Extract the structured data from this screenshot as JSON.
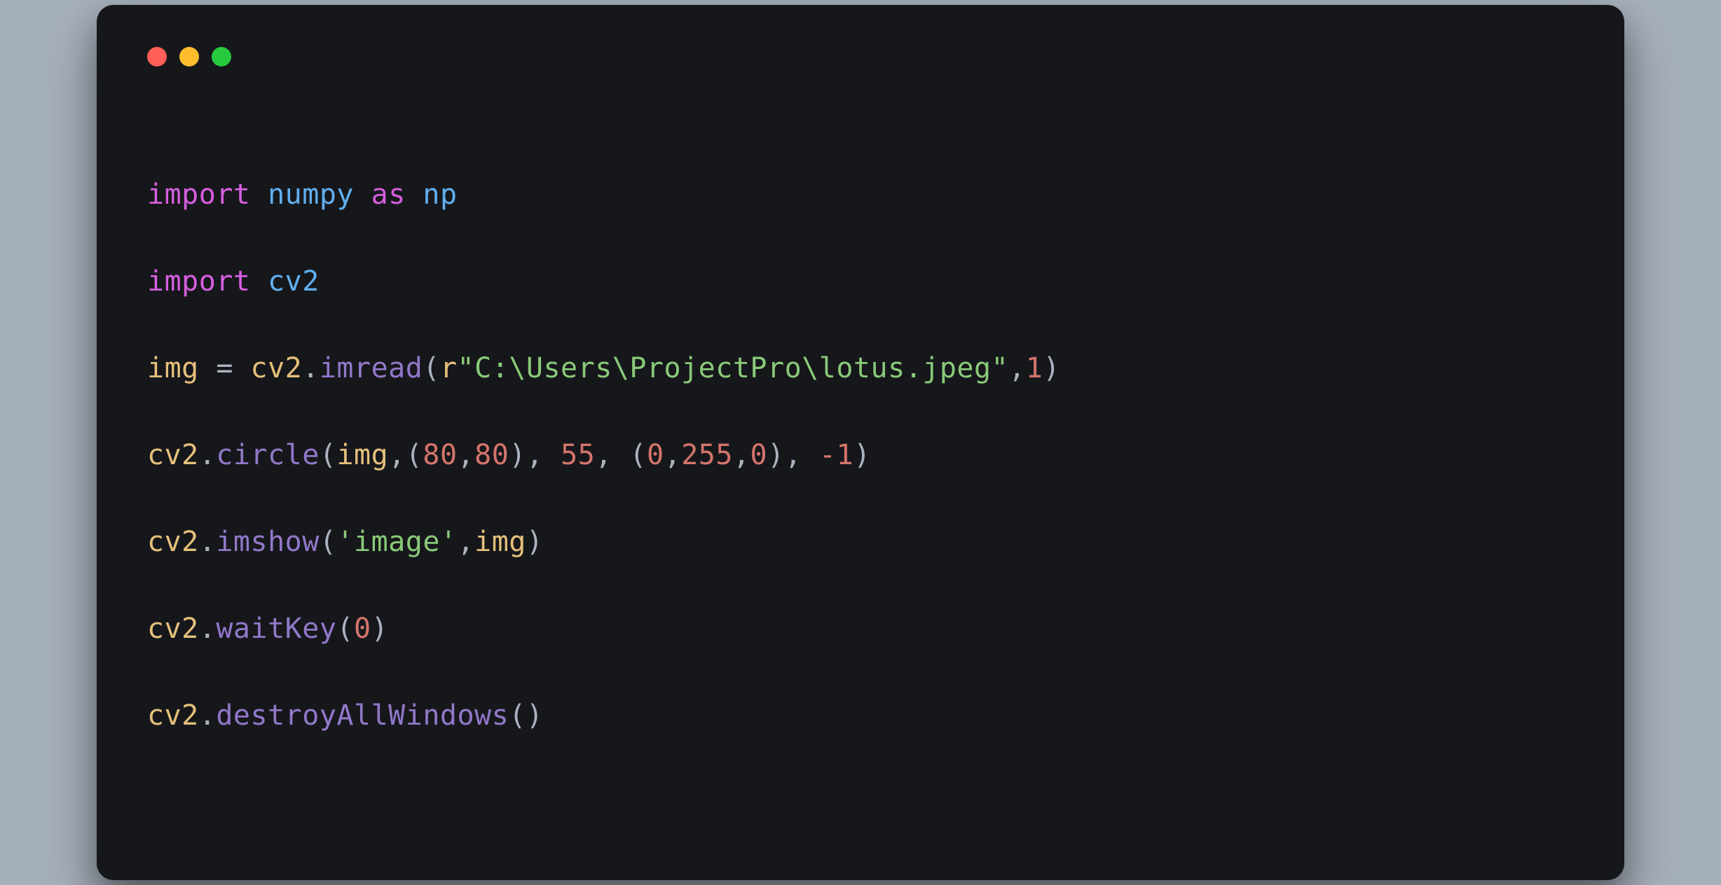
{
  "colors": {
    "red": "#ff5f56",
    "yellow": "#ffbd2e",
    "green": "#27c93f",
    "bg": "#16171b",
    "page_bg": "#a6b0bb"
  },
  "code": {
    "line1": {
      "kw1": "import",
      "mod1": "numpy",
      "kw2": "as",
      "mod2": "np"
    },
    "line2": {
      "kw1": "import",
      "mod1": "cv2"
    },
    "line3": {
      "var1": "img",
      "op1": " = ",
      "var2": "cv2",
      "dot": ".",
      "func": "imread",
      "lp": "(",
      "rprefix": "r",
      "str": "\"C:\\Users\\ProjectPro\\lotus.jpeg\"",
      "comma": ",",
      "num": "1",
      "rp": ")"
    },
    "line4": {
      "var1": "cv2",
      "dot": ".",
      "func": "circle",
      "lp": "(",
      "arg1": "img",
      "c1": ",",
      "lp2": "(",
      "n1": "80",
      "c2": ",",
      "n2": "80",
      "rp2": ")",
      "c3": ", ",
      "n3": "55",
      "c4": ", ",
      "lp3": "(",
      "n4": "0",
      "c5": ",",
      "n5": "255",
      "c6": ",",
      "n6": "0",
      "rp3": ")",
      "c7": ", ",
      "n7": "-1",
      "rp": ")"
    },
    "line5": {
      "var1": "cv2",
      "dot": ".",
      "func": "imshow",
      "lp": "(",
      "str": "'image'",
      "c1": ",",
      "arg1": "img",
      "rp": ")"
    },
    "line6": {
      "var1": "cv2",
      "dot": ".",
      "func": "waitKey",
      "lp": "(",
      "n1": "0",
      "rp": ")"
    },
    "line7": {
      "var1": "cv2",
      "dot": ".",
      "func": "destroyAllWindows",
      "lp": "(",
      "rp": ")"
    }
  }
}
